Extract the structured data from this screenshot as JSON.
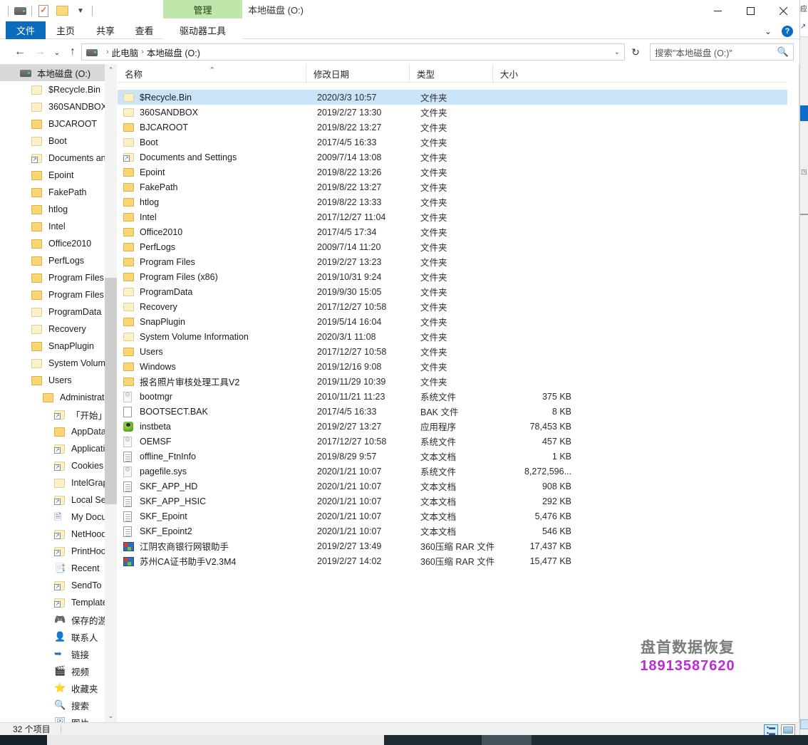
{
  "window": {
    "title": "本地磁盘 (O:)",
    "contextual_tab_title": "管理",
    "minimize_label": "—",
    "maximize_label": "▢",
    "close_label": "✕"
  },
  "quick_access_toolbar": {
    "items": [
      {
        "name": "drive-properties-icon",
        "label": ""
      },
      {
        "name": "properties-icon",
        "label": ""
      },
      {
        "name": "new-folder-icon",
        "label": ""
      },
      {
        "name": "customize-qat-caret",
        "label": "▼"
      }
    ]
  },
  "ribbon": {
    "tabs": [
      {
        "label": "文件",
        "selected": true
      },
      {
        "label": "主页",
        "selected": false
      },
      {
        "label": "共享",
        "selected": false
      },
      {
        "label": "查看",
        "selected": false
      },
      {
        "label": "驱动器工具",
        "selected": false,
        "contextual": true
      }
    ],
    "collapse_caret": "⌄",
    "help_label": "?"
  },
  "navigation": {
    "back": "←",
    "forward": "→",
    "recent_locations": "⌄",
    "up": "↑",
    "refresh": "↻",
    "breadcrumb": [
      "此电脑",
      "本地磁盘 (O:)"
    ],
    "breadcrumb_separator": "›",
    "address_dropdown": "⌄"
  },
  "search": {
    "placeholder": "搜索\"本地磁盘 (O:)\"",
    "value": "",
    "icon": "search-icon"
  },
  "sidebar": {
    "scroll_up": "⌃",
    "scroll_down": "⌄",
    "items": [
      {
        "label": "本地磁盘 (O:)",
        "icon": "drive",
        "indent": 1,
        "selected": true
      },
      {
        "label": "$Recycle.Bin",
        "icon": "folder-pale",
        "indent": 2,
        "selected": false
      },
      {
        "label": "360SANDBOX",
        "icon": "folder-pale",
        "indent": 2,
        "selected": false
      },
      {
        "label": "BJCAROOT",
        "icon": "folder",
        "indent": 2,
        "selected": false
      },
      {
        "label": "Boot",
        "icon": "folder-pale",
        "indent": 2,
        "selected": false
      },
      {
        "label": "Documents an",
        "icon": "folder-shortcut",
        "indent": 2,
        "selected": false
      },
      {
        "label": "Epoint",
        "icon": "folder",
        "indent": 2,
        "selected": false
      },
      {
        "label": "FakePath",
        "icon": "folder",
        "indent": 2,
        "selected": false
      },
      {
        "label": "htlog",
        "icon": "folder",
        "indent": 2,
        "selected": false
      },
      {
        "label": "Intel",
        "icon": "folder",
        "indent": 2,
        "selected": false
      },
      {
        "label": "Office2010",
        "icon": "folder",
        "indent": 2,
        "selected": false
      },
      {
        "label": "PerfLogs",
        "icon": "folder",
        "indent": 2,
        "selected": false
      },
      {
        "label": "Program Files",
        "icon": "folder",
        "indent": 2,
        "selected": false
      },
      {
        "label": "Program Files",
        "icon": "folder",
        "indent": 2,
        "selected": false
      },
      {
        "label": "ProgramData",
        "icon": "folder-pale",
        "indent": 2,
        "selected": false
      },
      {
        "label": "Recovery",
        "icon": "folder-pale",
        "indent": 2,
        "selected": false
      },
      {
        "label": "SnapPlugin",
        "icon": "folder",
        "indent": 2,
        "selected": false
      },
      {
        "label": "System Volum",
        "icon": "folder-pale",
        "indent": 2,
        "selected": false
      },
      {
        "label": "Users",
        "icon": "folder",
        "indent": 2,
        "selected": false
      },
      {
        "label": "Administrato",
        "icon": "folder",
        "indent": 3,
        "selected": false
      },
      {
        "label": "「开始」菜",
        "icon": "folder-shortcut",
        "indent": 4,
        "selected": false
      },
      {
        "label": "AppData",
        "icon": "folder",
        "indent": 4,
        "selected": false
      },
      {
        "label": "Application",
        "icon": "folder-shortcut",
        "indent": 4,
        "selected": false
      },
      {
        "label": "Cookies",
        "icon": "folder-shortcut",
        "indent": 4,
        "selected": false
      },
      {
        "label": "IntelGraph",
        "icon": "folder-pale",
        "indent": 4,
        "selected": false
      },
      {
        "label": "Local Settin",
        "icon": "folder-shortcut",
        "indent": 4,
        "selected": false
      },
      {
        "label": "My Docum",
        "icon": "documents",
        "indent": 4,
        "selected": false
      },
      {
        "label": "NetHood",
        "icon": "folder-shortcut",
        "indent": 4,
        "selected": false
      },
      {
        "label": "PrintHood",
        "icon": "folder-shortcut",
        "indent": 4,
        "selected": false
      },
      {
        "label": "Recent",
        "icon": "recent",
        "indent": 4,
        "selected": false
      },
      {
        "label": "SendTo",
        "icon": "folder-shortcut",
        "indent": 4,
        "selected": false
      },
      {
        "label": "Templates",
        "icon": "folder-shortcut",
        "indent": 4,
        "selected": false
      },
      {
        "label": "保存的游戏",
        "icon": "saved-games",
        "indent": 4,
        "selected": false
      },
      {
        "label": "联系人",
        "icon": "contacts",
        "indent": 4,
        "selected": false
      },
      {
        "label": "链接",
        "icon": "links",
        "indent": 4,
        "selected": false
      },
      {
        "label": "视频",
        "icon": "videos",
        "indent": 4,
        "selected": false
      },
      {
        "label": "收藏夹",
        "icon": "favorites",
        "indent": 4,
        "selected": false
      },
      {
        "label": "搜索",
        "icon": "searches",
        "indent": 4,
        "selected": false
      },
      {
        "label": "图片",
        "icon": "pictures",
        "indent": 4,
        "selected": false
      }
    ]
  },
  "file_list": {
    "columns": [
      {
        "label": "名称",
        "sorted": true,
        "sort_mark": "⌃"
      },
      {
        "label": "修改日期",
        "sorted": false
      },
      {
        "label": "类型",
        "sorted": false
      },
      {
        "label": "大小",
        "sorted": false
      }
    ],
    "rows": [
      {
        "name": "$Recycle.Bin",
        "date": "2020/3/3 10:57",
        "type": "文件夹",
        "size": "",
        "icon": "folder-pale",
        "selected": true
      },
      {
        "name": "360SANDBOX",
        "date": "2019/2/27 13:30",
        "type": "文件夹",
        "size": "",
        "icon": "folder-pale",
        "selected": false
      },
      {
        "name": "BJCAROOT",
        "date": "2019/8/22 13:27",
        "type": "文件夹",
        "size": "",
        "icon": "folder",
        "selected": false
      },
      {
        "name": "Boot",
        "date": "2017/4/5 16:33",
        "type": "文件夹",
        "size": "",
        "icon": "folder-pale",
        "selected": false
      },
      {
        "name": "Documents and Settings",
        "date": "2009/7/14 13:08",
        "type": "文件夹",
        "size": "",
        "icon": "folder-shortcut",
        "selected": false
      },
      {
        "name": "Epoint",
        "date": "2019/8/22 13:26",
        "type": "文件夹",
        "size": "",
        "icon": "folder",
        "selected": false
      },
      {
        "name": "FakePath",
        "date": "2019/8/22 13:27",
        "type": "文件夹",
        "size": "",
        "icon": "folder",
        "selected": false
      },
      {
        "name": "htlog",
        "date": "2019/8/22 13:33",
        "type": "文件夹",
        "size": "",
        "icon": "folder",
        "selected": false
      },
      {
        "name": "Intel",
        "date": "2017/12/27 11:04",
        "type": "文件夹",
        "size": "",
        "icon": "folder",
        "selected": false
      },
      {
        "name": "Office2010",
        "date": "2017/4/5 17:34",
        "type": "文件夹",
        "size": "",
        "icon": "folder",
        "selected": false
      },
      {
        "name": "PerfLogs",
        "date": "2009/7/14 11:20",
        "type": "文件夹",
        "size": "",
        "icon": "folder",
        "selected": false
      },
      {
        "name": "Program Files",
        "date": "2019/2/27 13:23",
        "type": "文件夹",
        "size": "",
        "icon": "folder",
        "selected": false
      },
      {
        "name": "Program Files (x86)",
        "date": "2019/10/31 9:24",
        "type": "文件夹",
        "size": "",
        "icon": "folder",
        "selected": false
      },
      {
        "name": "ProgramData",
        "date": "2019/9/30 15:05",
        "type": "文件夹",
        "size": "",
        "icon": "folder-pale",
        "selected": false
      },
      {
        "name": "Recovery",
        "date": "2017/12/27 10:58",
        "type": "文件夹",
        "size": "",
        "icon": "folder-pale",
        "selected": false
      },
      {
        "name": "SnapPlugin",
        "date": "2019/5/14 16:04",
        "type": "文件夹",
        "size": "",
        "icon": "folder",
        "selected": false
      },
      {
        "name": "System Volume Information",
        "date": "2020/3/1 11:08",
        "type": "文件夹",
        "size": "",
        "icon": "folder-pale",
        "selected": false
      },
      {
        "name": "Users",
        "date": "2017/12/27 10:58",
        "type": "文件夹",
        "size": "",
        "icon": "folder",
        "selected": false
      },
      {
        "name": "Windows",
        "date": "2019/12/16 9:08",
        "type": "文件夹",
        "size": "",
        "icon": "folder",
        "selected": false
      },
      {
        "name": "报名照片审核处理工具V2",
        "date": "2019/11/29 10:39",
        "type": "文件夹",
        "size": "",
        "icon": "folder",
        "selected": false
      },
      {
        "name": "bootmgr",
        "date": "2010/11/21 11:23",
        "type": "系统文件",
        "size": "375 KB",
        "icon": "system-file",
        "selected": false
      },
      {
        "name": "BOOTSECT.BAK",
        "date": "2017/4/5 16:33",
        "type": "BAK 文件",
        "size": "8 KB",
        "icon": "blank-file",
        "selected": false
      },
      {
        "name": "instbeta",
        "date": "2019/2/27 13:27",
        "type": "应用程序",
        "size": "78,453 KB",
        "icon": "application",
        "selected": false
      },
      {
        "name": "OEMSF",
        "date": "2017/12/27 10:58",
        "type": "系统文件",
        "size": "457 KB",
        "icon": "system-file",
        "selected": false
      },
      {
        "name": "offline_FtnInfo",
        "date": "2019/8/29 9:57",
        "type": "文本文档",
        "size": "1 KB",
        "icon": "text-file",
        "selected": false
      },
      {
        "name": "pagefile.sys",
        "date": "2020/1/21 10:07",
        "type": "系统文件",
        "size": "8,272,596...",
        "icon": "system-file",
        "selected": false
      },
      {
        "name": "SKF_APP_HD",
        "date": "2020/1/21 10:07",
        "type": "文本文档",
        "size": "908 KB",
        "icon": "text-file",
        "selected": false
      },
      {
        "name": "SKF_APP_HSIC",
        "date": "2020/1/21 10:07",
        "type": "文本文档",
        "size": "292 KB",
        "icon": "text-file",
        "selected": false
      },
      {
        "name": "SKF_Epoint",
        "date": "2020/1/21 10:07",
        "type": "文本文档",
        "size": "5,476 KB",
        "icon": "text-file",
        "selected": false
      },
      {
        "name": "SKF_Epoint2",
        "date": "2020/1/21 10:07",
        "type": "文本文档",
        "size": "546 KB",
        "icon": "text-file",
        "selected": false
      },
      {
        "name": "江阴农商银行网银助手",
        "date": "2019/2/27 13:49",
        "type": "360压缩 RAR 文件",
        "size": "17,437 KB",
        "icon": "rar-archive",
        "selected": false
      },
      {
        "name": "苏州CA证书助手V2.3M4",
        "date": "2019/2/27 14:02",
        "type": "360压缩 RAR 文件",
        "size": "15,477 KB",
        "icon": "rar-archive",
        "selected": false
      }
    ]
  },
  "watermark": {
    "line1": "盘首数据恢复",
    "line2": "18913587620",
    "line1_color": "#7b7b7b",
    "line2_color": "#bb2cd6"
  },
  "statusbar": {
    "item_count": "32 个项目",
    "view_details_label": "▤",
    "view_tiles_label": ""
  }
}
